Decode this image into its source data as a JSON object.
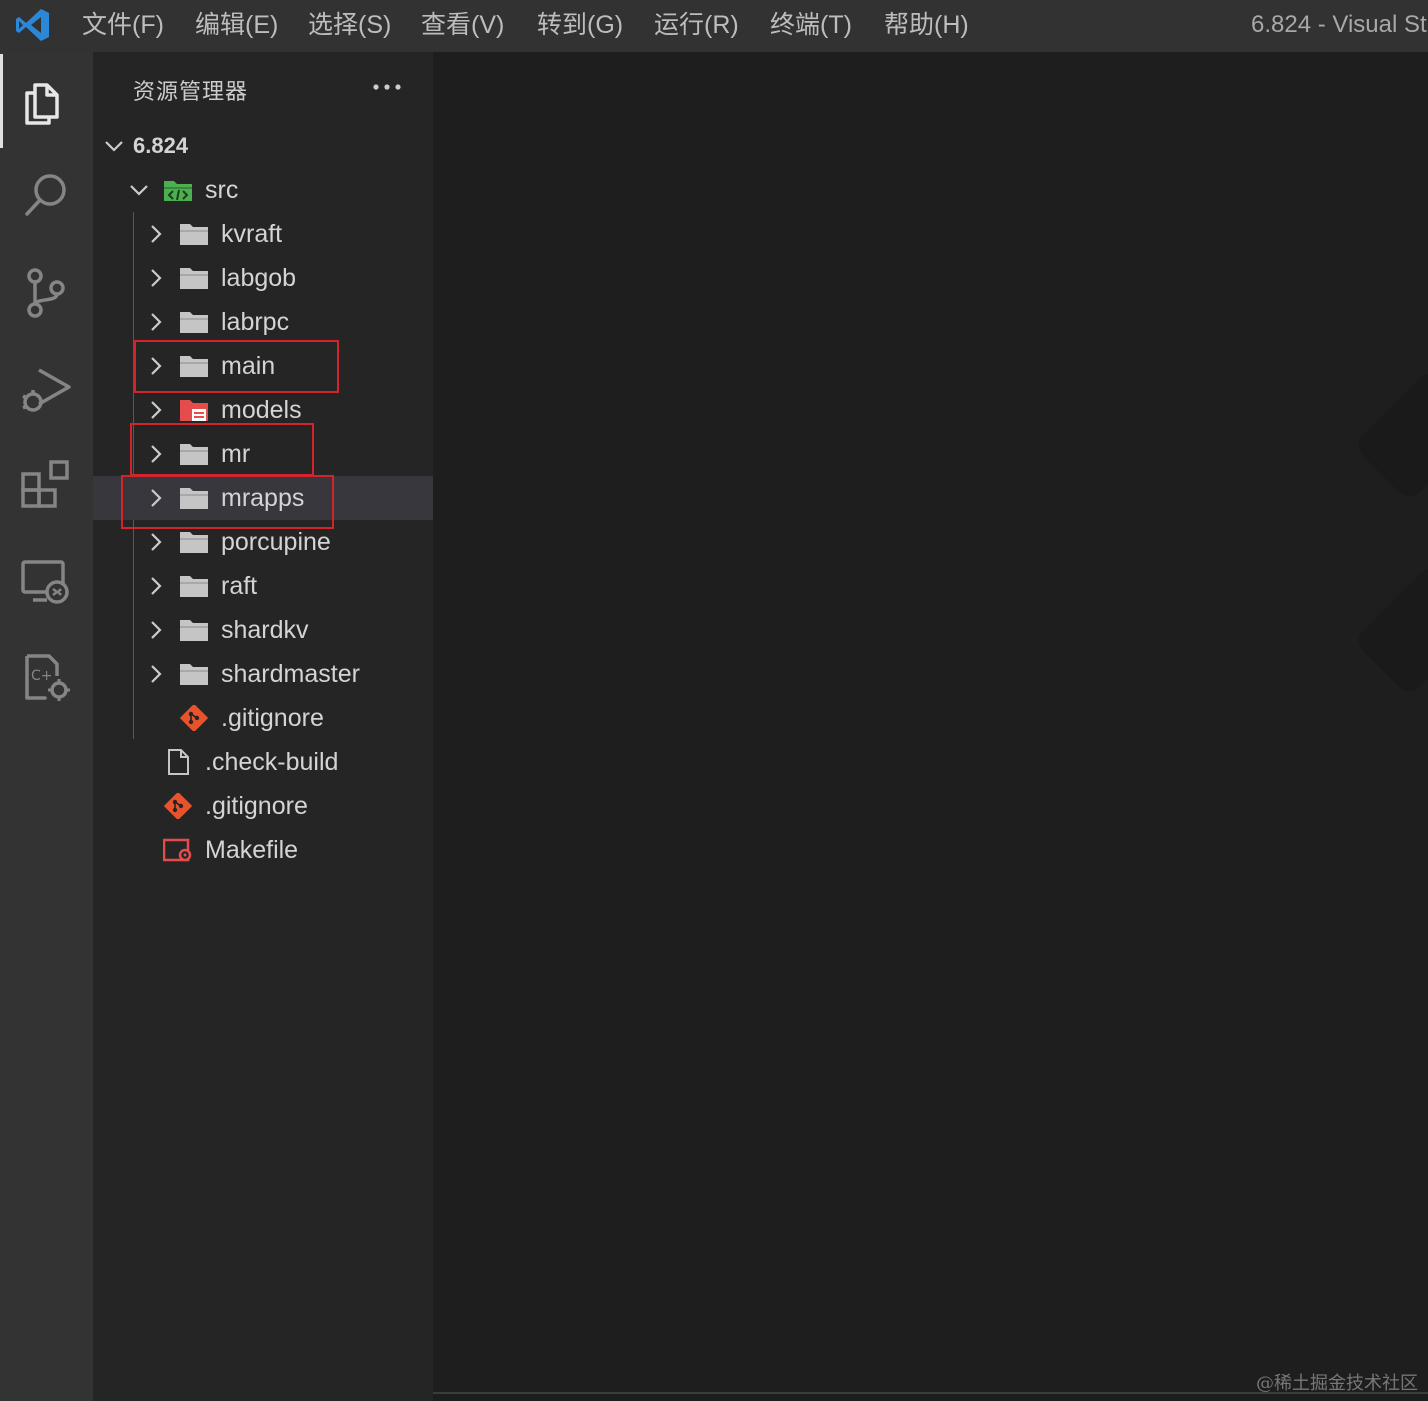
{
  "menubar": {
    "items": [
      "文件(F)",
      "编辑(E)",
      "选择(S)",
      "查看(V)",
      "转到(G)",
      "运行(R)",
      "终端(T)",
      "帮助(H)"
    ],
    "window_title": "6.824 - Visual Stu"
  },
  "activitybar": {
    "icons": [
      "explorer-icon",
      "search-icon",
      "source-control-icon",
      "run-debug-icon",
      "extensions-icon",
      "remote-explorer-icon",
      "cmake-icon"
    ]
  },
  "sidebar": {
    "title": "资源管理器",
    "more_actions": "···"
  },
  "tree": {
    "root": "6.824",
    "src": "src",
    "folders": [
      "kvraft",
      "labgob",
      "labrpc",
      "main",
      "models",
      "mr",
      "mrapps",
      "porcupine",
      "raft",
      "shardkv",
      "shardmaster"
    ],
    "src_gitignore": ".gitignore",
    "root_files": [
      ".check-build",
      ".gitignore",
      "Makefile"
    ],
    "selected": "mrapps",
    "highlighted": [
      "main",
      "mr",
      "mrapps"
    ]
  },
  "colors": {
    "highlight_border": "#d4242b",
    "vscode_blue": "#2b88d8",
    "src_folder_green": "#4caf50",
    "models_folder_red": "#e54d4d",
    "git_orange": "#e8532b"
  },
  "watermark": "@稀土掘金技术社区"
}
